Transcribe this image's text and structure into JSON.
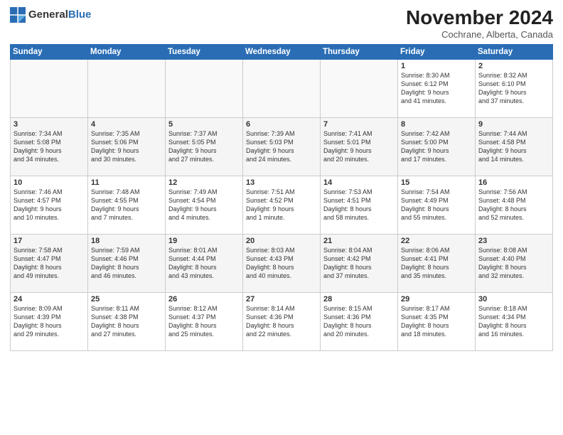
{
  "header": {
    "logo_general": "General",
    "logo_blue": "Blue",
    "month": "November 2024",
    "location": "Cochrane, Alberta, Canada"
  },
  "weekdays": [
    "Sunday",
    "Monday",
    "Tuesday",
    "Wednesday",
    "Thursday",
    "Friday",
    "Saturday"
  ],
  "weeks": [
    [
      {
        "day": "",
        "info": ""
      },
      {
        "day": "",
        "info": ""
      },
      {
        "day": "",
        "info": ""
      },
      {
        "day": "",
        "info": ""
      },
      {
        "day": "",
        "info": ""
      },
      {
        "day": "1",
        "info": "Sunrise: 8:30 AM\nSunset: 6:12 PM\nDaylight: 9 hours\nand 41 minutes."
      },
      {
        "day": "2",
        "info": "Sunrise: 8:32 AM\nSunset: 6:10 PM\nDaylight: 9 hours\nand 37 minutes."
      }
    ],
    [
      {
        "day": "3",
        "info": "Sunrise: 7:34 AM\nSunset: 5:08 PM\nDaylight: 9 hours\nand 34 minutes."
      },
      {
        "day": "4",
        "info": "Sunrise: 7:35 AM\nSunset: 5:06 PM\nDaylight: 9 hours\nand 30 minutes."
      },
      {
        "day": "5",
        "info": "Sunrise: 7:37 AM\nSunset: 5:05 PM\nDaylight: 9 hours\nand 27 minutes."
      },
      {
        "day": "6",
        "info": "Sunrise: 7:39 AM\nSunset: 5:03 PM\nDaylight: 9 hours\nand 24 minutes."
      },
      {
        "day": "7",
        "info": "Sunrise: 7:41 AM\nSunset: 5:01 PM\nDaylight: 9 hours\nand 20 minutes."
      },
      {
        "day": "8",
        "info": "Sunrise: 7:42 AM\nSunset: 5:00 PM\nDaylight: 9 hours\nand 17 minutes."
      },
      {
        "day": "9",
        "info": "Sunrise: 7:44 AM\nSunset: 4:58 PM\nDaylight: 9 hours\nand 14 minutes."
      }
    ],
    [
      {
        "day": "10",
        "info": "Sunrise: 7:46 AM\nSunset: 4:57 PM\nDaylight: 9 hours\nand 10 minutes."
      },
      {
        "day": "11",
        "info": "Sunrise: 7:48 AM\nSunset: 4:55 PM\nDaylight: 9 hours\nand 7 minutes."
      },
      {
        "day": "12",
        "info": "Sunrise: 7:49 AM\nSunset: 4:54 PM\nDaylight: 9 hours\nand 4 minutes."
      },
      {
        "day": "13",
        "info": "Sunrise: 7:51 AM\nSunset: 4:52 PM\nDaylight: 9 hours\nand 1 minute."
      },
      {
        "day": "14",
        "info": "Sunrise: 7:53 AM\nSunset: 4:51 PM\nDaylight: 8 hours\nand 58 minutes."
      },
      {
        "day": "15",
        "info": "Sunrise: 7:54 AM\nSunset: 4:49 PM\nDaylight: 8 hours\nand 55 minutes."
      },
      {
        "day": "16",
        "info": "Sunrise: 7:56 AM\nSunset: 4:48 PM\nDaylight: 8 hours\nand 52 minutes."
      }
    ],
    [
      {
        "day": "17",
        "info": "Sunrise: 7:58 AM\nSunset: 4:47 PM\nDaylight: 8 hours\nand 49 minutes."
      },
      {
        "day": "18",
        "info": "Sunrise: 7:59 AM\nSunset: 4:46 PM\nDaylight: 8 hours\nand 46 minutes."
      },
      {
        "day": "19",
        "info": "Sunrise: 8:01 AM\nSunset: 4:44 PM\nDaylight: 8 hours\nand 43 minutes."
      },
      {
        "day": "20",
        "info": "Sunrise: 8:03 AM\nSunset: 4:43 PM\nDaylight: 8 hours\nand 40 minutes."
      },
      {
        "day": "21",
        "info": "Sunrise: 8:04 AM\nSunset: 4:42 PM\nDaylight: 8 hours\nand 37 minutes."
      },
      {
        "day": "22",
        "info": "Sunrise: 8:06 AM\nSunset: 4:41 PM\nDaylight: 8 hours\nand 35 minutes."
      },
      {
        "day": "23",
        "info": "Sunrise: 8:08 AM\nSunset: 4:40 PM\nDaylight: 8 hours\nand 32 minutes."
      }
    ],
    [
      {
        "day": "24",
        "info": "Sunrise: 8:09 AM\nSunset: 4:39 PM\nDaylight: 8 hours\nand 29 minutes."
      },
      {
        "day": "25",
        "info": "Sunrise: 8:11 AM\nSunset: 4:38 PM\nDaylight: 8 hours\nand 27 minutes."
      },
      {
        "day": "26",
        "info": "Sunrise: 8:12 AM\nSunset: 4:37 PM\nDaylight: 8 hours\nand 25 minutes."
      },
      {
        "day": "27",
        "info": "Sunrise: 8:14 AM\nSunset: 4:36 PM\nDaylight: 8 hours\nand 22 minutes."
      },
      {
        "day": "28",
        "info": "Sunrise: 8:15 AM\nSunset: 4:36 PM\nDaylight: 8 hours\nand 20 minutes."
      },
      {
        "day": "29",
        "info": "Sunrise: 8:17 AM\nSunset: 4:35 PM\nDaylight: 8 hours\nand 18 minutes."
      },
      {
        "day": "30",
        "info": "Sunrise: 8:18 AM\nSunset: 4:34 PM\nDaylight: 8 hours\nand 16 minutes."
      }
    ]
  ]
}
